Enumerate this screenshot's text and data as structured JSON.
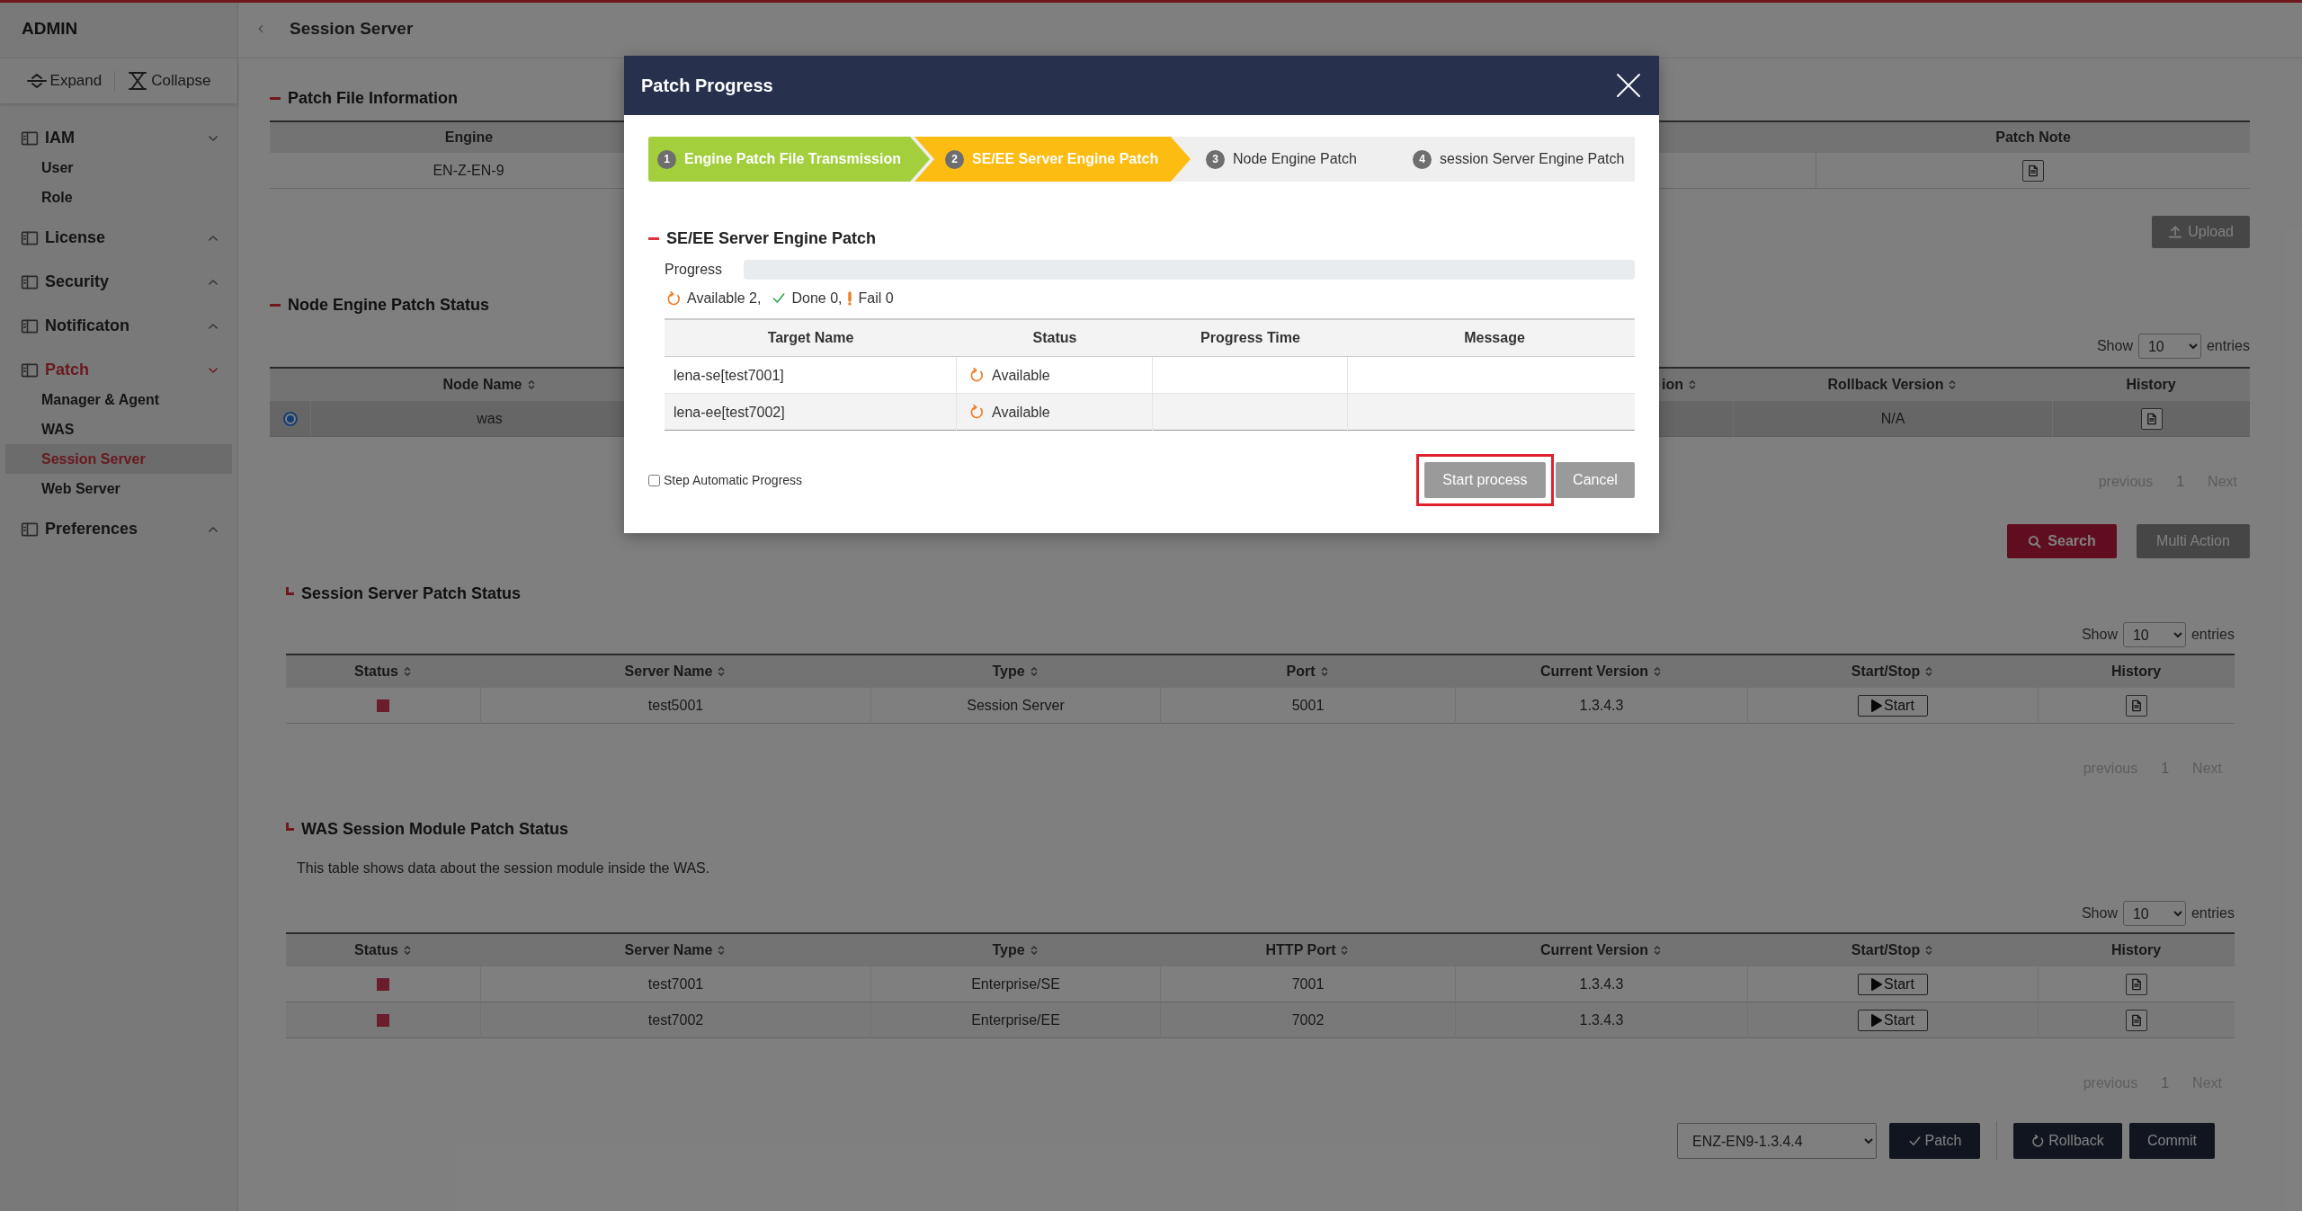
{
  "sidebar": {
    "title": "ADMIN",
    "expand": "Expand",
    "collapse": "Collapse",
    "groups": [
      {
        "label": "IAM",
        "expanded": true,
        "selected": false,
        "items": [
          {
            "label": "User",
            "selected": false
          },
          {
            "label": "Role",
            "selected": false
          }
        ]
      },
      {
        "label": "License",
        "expanded": false,
        "selected": false
      },
      {
        "label": "Security",
        "expanded": false,
        "selected": false
      },
      {
        "label": "Notificaton",
        "expanded": false,
        "selected": false
      },
      {
        "label": "Patch",
        "expanded": true,
        "selected": true,
        "items": [
          {
            "label": "Manager & Agent",
            "selected": false
          },
          {
            "label": "WAS",
            "selected": false
          },
          {
            "label": "Session Server",
            "selected": true
          },
          {
            "label": "Web Server",
            "selected": false
          }
        ]
      },
      {
        "label": "Preferences",
        "expanded": false,
        "selected": false
      }
    ]
  },
  "header": {
    "title": "Session Server"
  },
  "patch_file_info": {
    "title": "Patch File Information",
    "columns": [
      "Engine",
      "Patch Note"
    ],
    "rows": [
      {
        "engine": "EN-Z-EN-9"
      }
    ],
    "upload": "Upload"
  },
  "node_status": {
    "title": "Node Engine Patch Status",
    "show": "Show",
    "page_size": "10",
    "entries": "entries",
    "columns": [
      {
        "label": "Node Name",
        "sortable": true
      },
      {
        "label": "ion",
        "sortable": true
      },
      {
        "label": "Rollback Version",
        "sortable": true
      },
      {
        "label": "History",
        "sortable": false
      }
    ],
    "rows": [
      {
        "selected": true,
        "node_name": "was",
        "rollback_version": "N/A"
      }
    ],
    "pagination": {
      "previous": "previous",
      "page": "1",
      "next": "Next"
    },
    "search": "Search",
    "multi_action": "Multi Action"
  },
  "session_status": {
    "title": "Session Server Patch Status",
    "show": "Show",
    "page_size": "10",
    "entries": "entries",
    "columns": [
      {
        "label": "Status",
        "sortable": true
      },
      {
        "label": "Server Name",
        "sortable": true
      },
      {
        "label": "Type",
        "sortable": true
      },
      {
        "label": "Port",
        "sortable": true
      },
      {
        "label": "Current Version",
        "sortable": true
      },
      {
        "label": "Start/Stop",
        "sortable": true
      },
      {
        "label": "History",
        "sortable": false
      }
    ],
    "rows": [
      {
        "running": false,
        "cells": [
          "",
          "test5001",
          "Session Server",
          "5001",
          "1.3.4.3"
        ],
        "action": "Start"
      }
    ],
    "pagination": {
      "previous": "previous",
      "page": "1",
      "next": "Next"
    }
  },
  "was_status": {
    "title": "WAS Session Module Patch Status",
    "description": "This table shows data about the session module inside the WAS.",
    "show": "Show",
    "page_size": "10",
    "entries": "entries",
    "columns": [
      {
        "label": "Status",
        "sortable": true
      },
      {
        "label": "Server Name",
        "sortable": true
      },
      {
        "label": "Type",
        "sortable": true
      },
      {
        "label": "HTTP Port",
        "sortable": true
      },
      {
        "label": "Current Version",
        "sortable": true
      },
      {
        "label": "Start/Stop",
        "sortable": true
      },
      {
        "label": "History",
        "sortable": false
      }
    ],
    "rows": [
      {
        "running": false,
        "cells": [
          "",
          "test7001",
          "Enterprise/SE",
          "7001",
          "1.3.4.3"
        ],
        "action": "Start"
      },
      {
        "running": false,
        "cells": [
          "",
          "test7002",
          "Enterprise/EE",
          "7002",
          "1.3.4.3"
        ],
        "action": "Start"
      }
    ],
    "pagination": {
      "previous": "previous",
      "page": "1",
      "next": "Next"
    }
  },
  "footer": {
    "version_select": "ENZ-EN9-1.3.4.4",
    "patch": "Patch",
    "rollback": "Rollback",
    "commit": "Commit"
  },
  "modal": {
    "title": "Patch Progress",
    "steps": [
      {
        "number": "1",
        "label": "Engine Patch File Transmission",
        "done": true,
        "selected": false
      },
      {
        "number": "2",
        "label": "SE/EE Server Engine Patch",
        "done": false,
        "selected": true
      },
      {
        "number": "3",
        "label": "Node Engine Patch",
        "done": false,
        "selected": false
      },
      {
        "number": "4",
        "label": "session Server Engine Patch",
        "done": false,
        "selected": false
      }
    ],
    "section_title": "SE/EE Server Engine Patch",
    "progress": {
      "label": "Progress",
      "level": 0
    },
    "summary": {
      "available": "Available 2,",
      "done": "Done 0,",
      "fail": "Fail 0"
    },
    "columns": [
      "Target Name",
      "Status",
      "Progress Time",
      "Message"
    ],
    "rows": [
      {
        "target": "lena-se[test7001]",
        "status": "Available"
      },
      {
        "target": "lena-ee[test7002]",
        "status": "Available"
      }
    ],
    "auto_progress": {
      "label": "Step Automatic Progress",
      "checked": false
    },
    "start": {
      "label": "Start process",
      "highlighted": true
    },
    "cancel": "Cancel"
  }
}
